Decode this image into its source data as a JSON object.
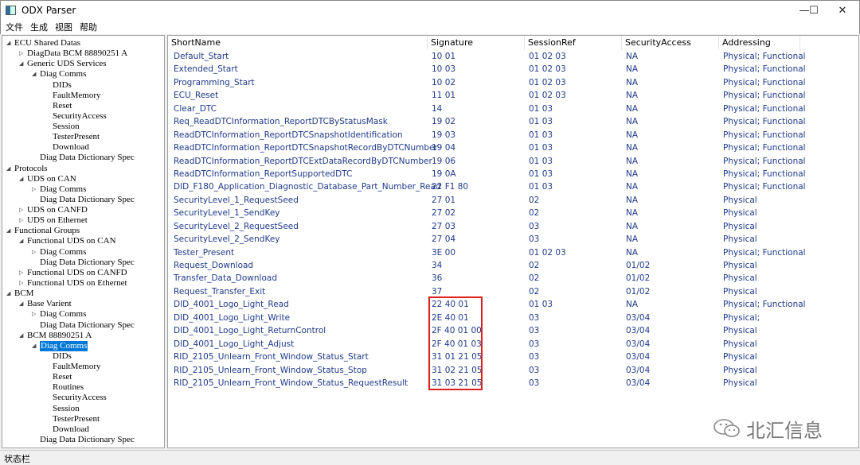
{
  "window": {
    "title": "ODX Parser",
    "minimize_icon": "minimize-icon",
    "maximize_icon": "maximize-icon",
    "close_icon": "close-icon"
  },
  "menu": [
    "文件",
    "生成",
    "视图",
    "帮助"
  ],
  "tree": [
    {
      "label": "ECU Shared Datas",
      "level": 0,
      "state": "expanded"
    },
    {
      "label": "DiagData BCM 88890251 A",
      "level": 1,
      "state": "collapsed"
    },
    {
      "label": "Generic UDS Services",
      "level": 1,
      "state": "expanded"
    },
    {
      "label": "Diag Comms",
      "level": 2,
      "state": "expanded"
    },
    {
      "label": "DIDs",
      "level": 3,
      "state": "leaf"
    },
    {
      "label": "FaultMemory",
      "level": 3,
      "state": "leaf"
    },
    {
      "label": "Reset",
      "level": 3,
      "state": "leaf"
    },
    {
      "label": "SecurityAccess",
      "level": 3,
      "state": "leaf"
    },
    {
      "label": "Session",
      "level": 3,
      "state": "leaf"
    },
    {
      "label": "TesterPresent",
      "level": 3,
      "state": "leaf"
    },
    {
      "label": "Download",
      "level": 3,
      "state": "leaf"
    },
    {
      "label": "Diag Data Dictionary Spec",
      "level": 2,
      "state": "leaf"
    },
    {
      "label": "Protocols",
      "level": 0,
      "state": "expanded"
    },
    {
      "label": "UDS on CAN",
      "level": 1,
      "state": "expanded"
    },
    {
      "label": "Diag Comms",
      "level": 2,
      "state": "collapsed"
    },
    {
      "label": "Diag Data Dictionary Spec",
      "level": 2,
      "state": "leaf"
    },
    {
      "label": "UDS on CANFD",
      "level": 1,
      "state": "collapsed"
    },
    {
      "label": "UDS on Ethernet",
      "level": 1,
      "state": "collapsed"
    },
    {
      "label": "Functional Groups",
      "level": 0,
      "state": "expanded"
    },
    {
      "label": "Functional UDS on CAN",
      "level": 1,
      "state": "expanded"
    },
    {
      "label": "Diag Comms",
      "level": 2,
      "state": "collapsed"
    },
    {
      "label": "Diag Data Dictionary Spec",
      "level": 2,
      "state": "leaf"
    },
    {
      "label": "Functional UDS on CANFD",
      "level": 1,
      "state": "collapsed"
    },
    {
      "label": "Functional UDS on Ethernet",
      "level": 1,
      "state": "collapsed"
    },
    {
      "label": "BCM",
      "level": 0,
      "state": "expanded"
    },
    {
      "label": "Base Varient",
      "level": 1,
      "state": "expanded"
    },
    {
      "label": "Diag Comms",
      "level": 2,
      "state": "collapsed"
    },
    {
      "label": "Diag Data Dictionary Spec",
      "level": 2,
      "state": "leaf"
    },
    {
      "label": "BCM 88890251 A",
      "level": 1,
      "state": "expanded"
    },
    {
      "label": "Diag Comms",
      "level": 2,
      "state": "expanded",
      "selected": true
    },
    {
      "label": "DIDs",
      "level": 3,
      "state": "leaf"
    },
    {
      "label": "FaultMemory",
      "level": 3,
      "state": "leaf"
    },
    {
      "label": "Reset",
      "level": 3,
      "state": "leaf"
    },
    {
      "label": "Routines",
      "level": 3,
      "state": "leaf"
    },
    {
      "label": "SecurityAccess",
      "level": 3,
      "state": "leaf"
    },
    {
      "label": "Session",
      "level": 3,
      "state": "leaf"
    },
    {
      "label": "TesterPresent",
      "level": 3,
      "state": "leaf"
    },
    {
      "label": "Download",
      "level": 3,
      "state": "leaf"
    },
    {
      "label": "Diag Data Dictionary Spec",
      "level": 2,
      "state": "leaf"
    }
  ],
  "table": {
    "columns": [
      "ShortName",
      "Signature",
      "SessionRef",
      "SecurityAccess",
      "Addressing"
    ],
    "rows": [
      [
        "Default_Start",
        "10 01",
        "01 02 03",
        "NA",
        "Physical; Functional"
      ],
      [
        "Extended_Start",
        "10 03",
        "01 02 03",
        "NA",
        "Physical; Functional"
      ],
      [
        "Programming_Start",
        "10 02",
        "01 02 03",
        "NA",
        "Physical; Functional"
      ],
      [
        "ECU_Reset",
        "11 01",
        "01 02 03",
        "NA",
        "Physical; Functional"
      ],
      [
        "Clear_DTC",
        "14",
        "01 03",
        "NA",
        "Physical; Functional"
      ],
      [
        "Req_ReadDTCInformation_ReportDTCByStatusMask",
        "19 02",
        "01 03",
        "NA",
        "Physical; Functional"
      ],
      [
        "ReadDTCInformation_ReportDTCSnapshotIdentification",
        "19 03",
        "01 03",
        "NA",
        "Physical; Functional"
      ],
      [
        "ReadDTCInformation_ReportDTCSnapshotRecordByDTCNumber",
        "19 04",
        "01 03",
        "NA",
        "Physical; Functional"
      ],
      [
        "ReadDTCInformation_ReportDTCExtDataRecordByDTCNumber",
        "19 06",
        "01 03",
        "NA",
        "Physical; Functional"
      ],
      [
        "ReadDTCInformation_ReportSupportedDTC",
        "19 0A",
        "01 03",
        "NA",
        "Physical; Functional"
      ],
      [
        "DID_F180_Application_Diagnostic_Database_Part_Number_Read",
        "22 F1 80",
        "01 03",
        "NA",
        "Physical; Functional"
      ],
      [
        "SecurityLevel_1_RequestSeed",
        "27 01",
        "02",
        "NA",
        "Physical"
      ],
      [
        "SecurityLevel_1_SendKey",
        "27 02",
        "02",
        "NA",
        "Physical"
      ],
      [
        "SecurityLevel_2_RequestSeed",
        "27 03",
        "03",
        "NA",
        "Physical"
      ],
      [
        "SecurityLevel_2_SendKey",
        "27 04",
        "03",
        "NA",
        "Physical"
      ],
      [
        "Tester_Present",
        "3E 00",
        "01 02 03",
        "NA",
        "Physical; Functional"
      ],
      [
        "Request_Download",
        "34",
        "02",
        "01/02",
        "Physical"
      ],
      [
        "Transfer_Data_Download",
        "36",
        "02",
        "01/02",
        "Physical"
      ],
      [
        "Request_Transfer_Exit",
        "37",
        "02",
        "01/02",
        "Physical"
      ],
      [
        "DID_4001_Logo_Light_Read",
        "22 40 01",
        "01 03",
        "NA",
        "Physical; Functional"
      ],
      [
        "DID_4001_Logo_Light_Write",
        "2E 40 01",
        "03",
        "03/04",
        "Physical;"
      ],
      [
        "DID_4001_Logo_Light_ReturnControl",
        "2F 40 01 00",
        "03",
        "03/04",
        "Physical"
      ],
      [
        "DID_4001_Logo_Light_Adjust",
        "2F 40 01 03",
        "03",
        "03/04",
        "Physical"
      ],
      [
        "RID_2105_Unlearn_Front_Window_Status_Start",
        "31 01 21 05",
        "03",
        "03/04",
        "Physical"
      ],
      [
        "RID_2105_Unlearn_Front_Window_Status_Stop",
        "31 02 21 05",
        "03",
        "03/04",
        "Physical"
      ],
      [
        "RID_2105_Unlearn_Front_Window_Status_RequestResult",
        "31 03 21 05",
        "03",
        "03/04",
        "Physical"
      ]
    ]
  },
  "highlight_color": "#e0201f",
  "selection_color": "#0078d7",
  "text_color": "#1f3a8a",
  "statusbar": {
    "text": "状态栏"
  },
  "watermark": {
    "text": "北汇信息",
    "icon": "wechat-icon"
  }
}
